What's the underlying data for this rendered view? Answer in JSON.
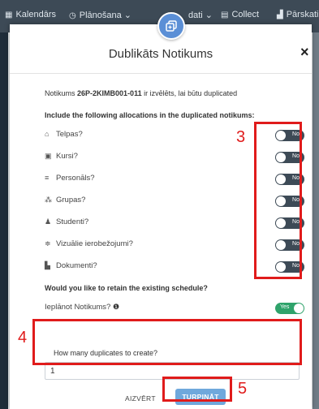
{
  "topnav": {
    "items": [
      {
        "icon": "calendar-icon",
        "label": "Kalendārs"
      },
      {
        "icon": "clock-icon",
        "label": "Plānošana ⌄"
      },
      {
        "icon": "",
        "label": "dati ⌄"
      },
      {
        "icon": "list-icon",
        "label": "Collect"
      },
      {
        "icon": "bar-chart-icon",
        "label": "Pārskati"
      }
    ]
  },
  "modal": {
    "title": "Dublikāts Notikums",
    "close_label": "×",
    "notice_prefix": "Notikums",
    "notice_code": "26P-2KIMB001-011",
    "notice_suffix": "ir izvēlēts, lai būtu duplicated",
    "section_heading": "Include the following allocations in the duplicated notikums:",
    "allocations": [
      {
        "icon": "home-icon",
        "label": "Telpas?",
        "value": "No"
      },
      {
        "icon": "book-icon",
        "label": "Kursi?",
        "value": "No"
      },
      {
        "icon": "personnel-icon",
        "label": "Personāls?",
        "value": "No"
      },
      {
        "icon": "groups-icon",
        "label": "Grupas?",
        "value": "No"
      },
      {
        "icon": "student-icon",
        "label": "Studenti?",
        "value": "No"
      },
      {
        "icon": "sliders-icon",
        "label": "Vizuālie ierobežojumi?",
        "value": "No"
      },
      {
        "icon": "document-icon",
        "label": "Dokumenti?",
        "value": "No"
      }
    ],
    "retain_question": "Would you like to retain the existing schedule?",
    "schedule_label": "Ieplānot Notikums?",
    "schedule_value": "Yes",
    "duplicates_label": "How many duplicates to create?",
    "duplicates_value": "1",
    "cancel_label": "AIZVĒRT",
    "continue_label": "TURPINĀT"
  },
  "annotations": {
    "three": "3",
    "four": "4",
    "five": "5"
  },
  "colors": {
    "annotation": "#e01b1b",
    "toggle_off": "#3d4a56",
    "toggle_on": "#2fa36b",
    "primary_button": "#6fa8dc"
  }
}
